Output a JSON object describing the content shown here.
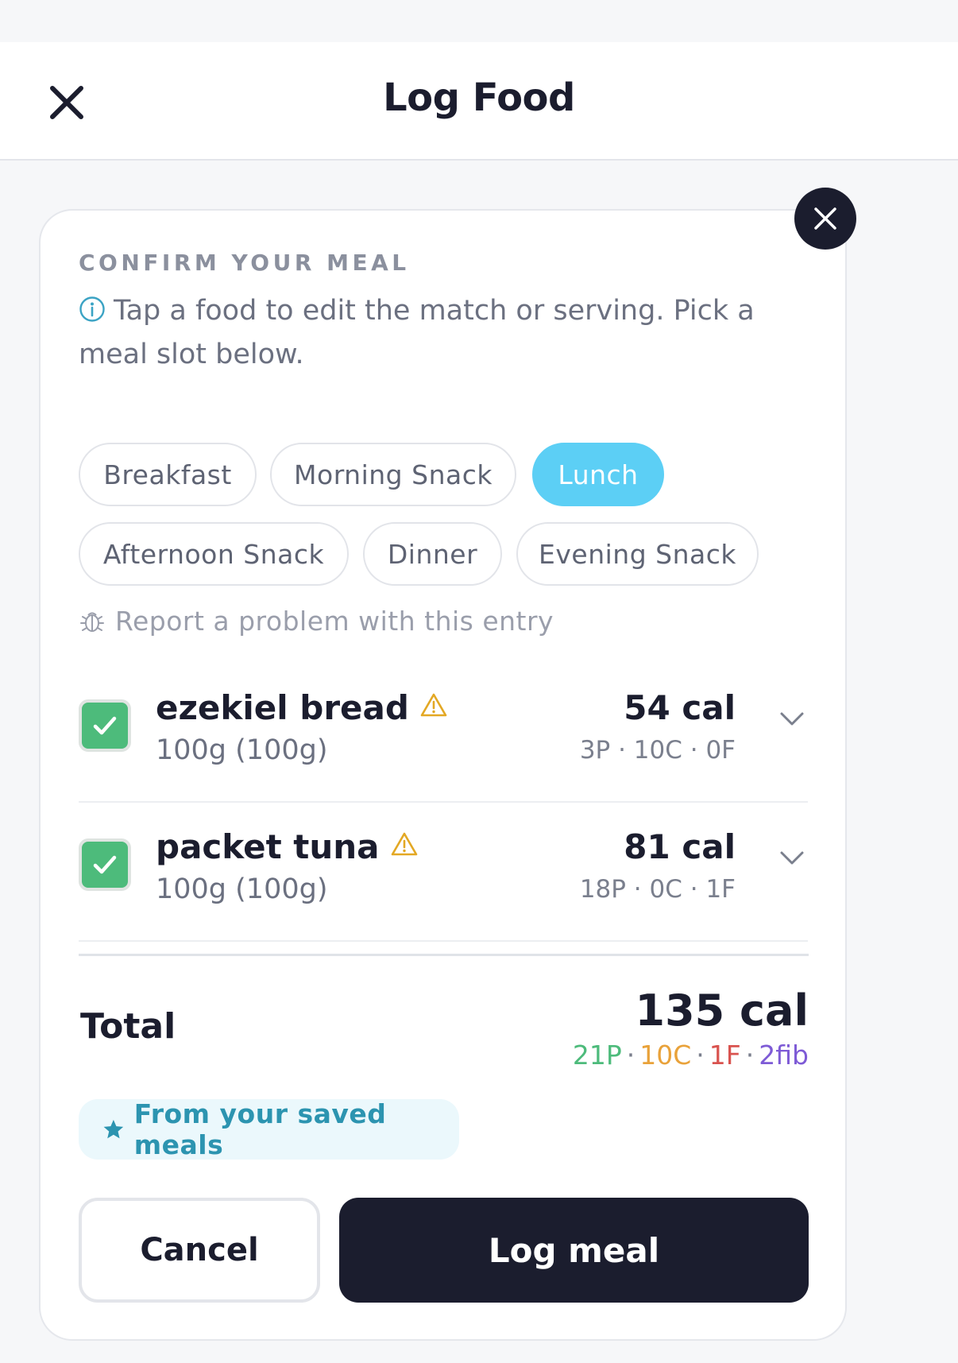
{
  "header": {
    "title": "Log Food",
    "close_icon": "close-icon"
  },
  "card": {
    "section_label": "CONFIRM YOUR MEAL",
    "info_text": "Tap a food to edit the match or serving. Pick a meal slot below.",
    "meal_slots": [
      {
        "label": "Breakfast",
        "selected": false
      },
      {
        "label": "Morning Snack",
        "selected": false
      },
      {
        "label": "Lunch",
        "selected": true
      },
      {
        "label": "Afternoon Snack",
        "selected": false
      },
      {
        "label": "Dinner",
        "selected": false
      },
      {
        "label": "Evening Snack",
        "selected": false
      }
    ],
    "report_link": "Report a problem with this entry",
    "foods": [
      {
        "name": "ezekiel bread",
        "serving": "100g (100g)",
        "calories": "54 cal",
        "macros": "3P · 10C · 0F",
        "checked": true,
        "warning": true
      },
      {
        "name": "packet tuna",
        "serving": "100g (100g)",
        "calories": "81 cal",
        "macros": "18P · 0C · 1F",
        "checked": true,
        "warning": true
      }
    ],
    "total": {
      "label": "Total",
      "calories": "135 cal",
      "protein": "21P",
      "carbs": "10C",
      "fat": "1F",
      "fiber": "2fib"
    },
    "saved_badge": "From your saved meals",
    "cancel_label": "Cancel",
    "log_label": "Log meal"
  },
  "colors": {
    "accent": "#5ccff5",
    "check": "#4dbb7b",
    "warning": "#e3a824",
    "protein": "#4dbb7b",
    "carbs": "#e9a23a",
    "fat": "#d9534f",
    "fiber": "#7e5bd6",
    "dark": "#1b1d2e"
  }
}
